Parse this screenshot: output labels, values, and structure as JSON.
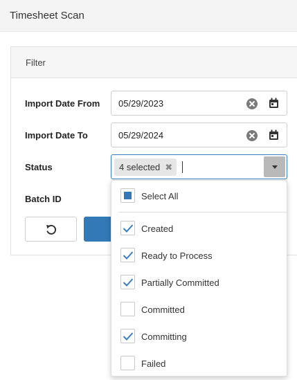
{
  "header": {
    "title": "Timesheet Scan"
  },
  "filter": {
    "title": "Filter",
    "import_date_from": {
      "label": "Import Date From",
      "value": "05/29/2023"
    },
    "import_date_to": {
      "label": "Import Date To",
      "value": "05/29/2024"
    },
    "status": {
      "label": "Status",
      "chip": "4 selected"
    },
    "batch_id": {
      "label": "Batch ID"
    }
  },
  "status_dropdown": {
    "select_all": "Select All",
    "options": [
      {
        "label": "Created",
        "checked": true
      },
      {
        "label": "Ready to Process",
        "checked": true
      },
      {
        "label": "Partially Committed",
        "checked": true
      },
      {
        "label": "Committed",
        "checked": false
      },
      {
        "label": "Committing",
        "checked": true
      },
      {
        "label": "Failed",
        "checked": false
      }
    ]
  },
  "colors": {
    "accent": "#3379b7",
    "header_bg": "#f4f4f4",
    "check": "#3a7ec1"
  },
  "icons": {
    "clear": "clear-icon",
    "calendar": "calendar-icon",
    "reset": "reset-icon",
    "dropdown": "chevron-down-icon"
  }
}
